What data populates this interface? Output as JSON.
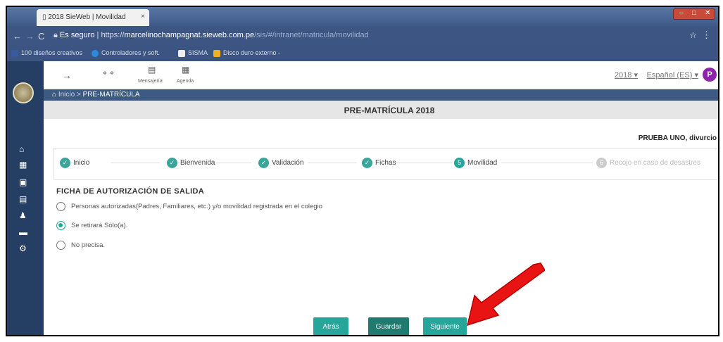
{
  "browser": {
    "tab_title": "2018 SieWeb | Movilidad",
    "tab_close": "×",
    "address": {
      "secure_label": "Es seguro",
      "scheme": "https://",
      "host": "marcelinochampagnat.sieweb.com.pe",
      "path": "/sis/#/intranet/matricula/movilidad"
    },
    "bookmarks": [
      {
        "label": "100 diseños creativos",
        "icon": "bookmark-icon",
        "color": "#3a5aa0"
      },
      {
        "label": "Controladores y soft.",
        "icon": "globe-icon",
        "color": "#2b8be0"
      },
      {
        "label": "SISMA",
        "icon": "page-icon",
        "color": "#eeeeee"
      },
      {
        "label": "Disco duro externo -",
        "icon": "drive-icon",
        "color": "#f2b01e"
      }
    ]
  },
  "toolbar": {
    "items": [
      {
        "icon": "arrow-right-icon",
        "label": ""
      },
      {
        "icon": "hierarchy-icon",
        "label": ""
      },
      {
        "icon": "message-icon",
        "label": "Mensajería"
      },
      {
        "icon": "calendar-icon",
        "label": "Agenda"
      }
    ],
    "year": "2018",
    "language": "Español (ES)",
    "avatar_initial": "P",
    "avatar_color": "#8e24aa"
  },
  "sidebar": {
    "icons": [
      "home-icon",
      "calendar-icon",
      "print-icon",
      "id-card-icon",
      "graduate-icon",
      "payment-icon",
      "bus-icon"
    ]
  },
  "breadcrumb": {
    "home": "Inicio",
    "separator": ">",
    "current": "PRE-MATRÍCULA"
  },
  "page": {
    "title": "PRE-MATRÍCULA 2018",
    "student": "PRUEBA UNO, divurcio"
  },
  "steps": [
    {
      "label": "Inicio",
      "state": "done"
    },
    {
      "label": "Bienvenida",
      "state": "done"
    },
    {
      "label": "Validación",
      "state": "done"
    },
    {
      "label": "Fichas",
      "state": "done"
    },
    {
      "label": "Movilidad",
      "state": "active",
      "number": "5"
    },
    {
      "label": "Recojo en caso de desastres",
      "state": "disabled",
      "number": "6"
    }
  ],
  "form": {
    "section_title": "FICHA DE AUTORIZACIÓN DE SALIDA",
    "options": [
      {
        "label": "Personas autorizadas(Padres, Familiares, etc.) y/o movilidad registrada en el colegio",
        "checked": false
      },
      {
        "label": "Se retirará Sólo(a).",
        "checked": true
      },
      {
        "label": "No precisa.",
        "checked": false
      }
    ]
  },
  "buttons": {
    "back": "Atrás",
    "save": "Guardar",
    "next": "Siguiente"
  },
  "colors": {
    "accent": "#26a69a",
    "sidebar": "#253e63",
    "annotation_arrow": "#e81414"
  }
}
